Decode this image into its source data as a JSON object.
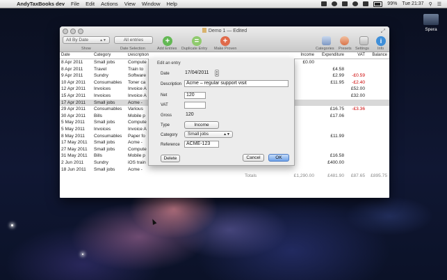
{
  "menubar": {
    "app": "AndyTaxBooks dev",
    "items": [
      "File",
      "Edit",
      "Actions",
      "View",
      "Window",
      "Help"
    ],
    "battery": "99%",
    "clock": "Tue 21:37"
  },
  "desktop": {
    "icon_label": "Spera"
  },
  "window": {
    "title": "Demo 1 — Edited",
    "toolbar": {
      "sort_select": "All By Date",
      "show_label": "Show",
      "filter_select": "All entries",
      "date_selection_label": "Date Selection",
      "add_entries": "Add Entries",
      "duplicate_entry": "Duplicate Entry",
      "make_proven": "Make Proven",
      "categories": "Categories",
      "presets": "Presets",
      "settings": "Settings",
      "info": "Info"
    },
    "columns": [
      "Date",
      "Category",
      "Description",
      "Income",
      "Expenditure",
      "VAT",
      "Balance"
    ],
    "rows": [
      {
        "date": "8 Apr 2011",
        "cat": "Small jobs",
        "desc": "Compute",
        "inc": "£0.00",
        "exp": "",
        "vat": "",
        "bal": ""
      },
      {
        "date": "8 Apr 2011",
        "cat": "Travel",
        "desc": "Train to",
        "inc": "",
        "exp": "£4.58",
        "vat": "",
        "bal": ""
      },
      {
        "date": "9 Apr 2011",
        "cat": "Sundry",
        "desc": "Software",
        "inc": "",
        "exp": "£2.99",
        "vat": "-£0.59",
        "bal": ""
      },
      {
        "date": "10 Apr 2011",
        "cat": "Consumables",
        "desc": "Toner ca",
        "inc": "",
        "exp": "£11.95",
        "vat": "-£2.40",
        "bal": ""
      },
      {
        "date": "12 Apr 2011",
        "cat": "Invoices",
        "desc": "Invoice A",
        "inc": "",
        "exp": "",
        "vat": "£52.00",
        "bal": ""
      },
      {
        "date": "15 Apr 2011",
        "cat": "Invoices",
        "desc": "Invoice A",
        "inc": "",
        "exp": "",
        "vat": "£32.00",
        "bal": ""
      },
      {
        "date": "17 Apr 2011",
        "cat": "Small jobs",
        "desc": "Acme -",
        "inc": "",
        "exp": "",
        "vat": "",
        "bal": "",
        "selected": true
      },
      {
        "date": "29 Apr 2011",
        "cat": "Consumables",
        "desc": "Various",
        "inc": "",
        "exp": "£16.75",
        "vat": "-£3.36",
        "bal": ""
      },
      {
        "date": "30 Apr 2011",
        "cat": "Bills",
        "desc": "Mobile p",
        "inc": "",
        "exp": "£17.06",
        "vat": "",
        "bal": ""
      },
      {
        "date": "5 May 2011",
        "cat": "Small jobs",
        "desc": "Compute",
        "inc": "",
        "exp": "",
        "vat": "",
        "bal": ""
      },
      {
        "date": "5 May 2011",
        "cat": "Invoices",
        "desc": "Invoice A",
        "inc": "",
        "exp": "",
        "vat": "",
        "bal": ""
      },
      {
        "date": "8 May 2011",
        "cat": "Consumables",
        "desc": "Paper fo",
        "inc": "",
        "exp": "£11.99",
        "vat": "",
        "bal": ""
      },
      {
        "date": "17 May 2011",
        "cat": "Small jobs",
        "desc": "Acme -",
        "inc": "",
        "exp": "",
        "vat": "",
        "bal": ""
      },
      {
        "date": "27 May 2011",
        "cat": "Small jobs",
        "desc": "Compute",
        "inc": "",
        "exp": "",
        "vat": "",
        "bal": ""
      },
      {
        "date": "31 May 2011",
        "cat": "Bills",
        "desc": "Mobile p",
        "inc": "",
        "exp": "£16.58",
        "vat": "",
        "bal": ""
      },
      {
        "date": "2 Jun 2011",
        "cat": "Sundry",
        "desc": "iOS train",
        "inc": "",
        "exp": "£400.00",
        "vat": "",
        "bal": ""
      },
      {
        "date": "18 Jun 2011",
        "cat": "Small jobs",
        "desc": "Acme -",
        "inc": "",
        "exp": "",
        "vat": "",
        "bal": ""
      }
    ],
    "totals": {
      "label": "Totals",
      "income": "£1,290.00",
      "expenditure": "£481.90",
      "vat": "£87.65",
      "balance": "£895.75"
    }
  },
  "sheet": {
    "title": "Edit an entry",
    "date_label": "Date",
    "date_value": "17/04/2011",
    "description_label": "Description",
    "description_value": "Acme – regular support visit",
    "net_label": "Net",
    "net_value": "120",
    "vat_label": "VAT",
    "vat_value": "",
    "gross_label": "Gross",
    "gross_value": "120",
    "type_label": "Type",
    "type_value": "Income",
    "category_label": "Category",
    "category_value": "Small jobs",
    "reference_label": "Reference",
    "reference_value": "ACME-123",
    "delete_button": "Delete",
    "cancel_button": "Cancel",
    "ok_button": "OK"
  },
  "colors": {
    "ok_button": "#6fa2e9",
    "negative": "#c00000",
    "add_green": "#66bb55",
    "make_orange": "#e06a4a"
  },
  "icons": [
    "apple-icon",
    "wifi-icon",
    "battery-icon",
    "search-icon",
    "list-icon"
  ]
}
